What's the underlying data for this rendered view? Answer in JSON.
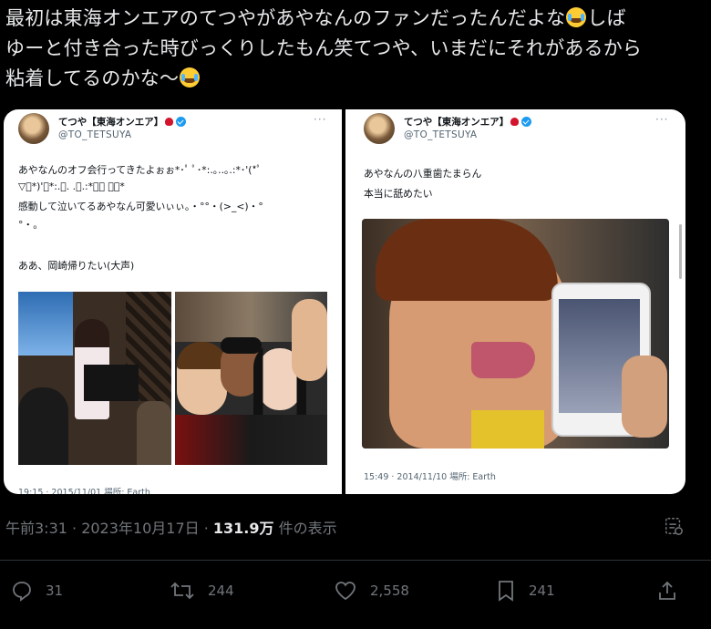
{
  "tweet": {
    "line1_a": "最初は東海オンエアのてつやがあやなんのファンだったんだよな",
    "line1_b": "しば",
    "line2": "ゆーと付き合った時びっくりしたもん笑てつや、いまだにそれがあるから",
    "line3": "粘着してるのかな〜",
    "emoji_name": "face-with-tears-of-joy-icon"
  },
  "left_card": {
    "display_name": "てつや【東海オンエア】",
    "handle": "@TO_TETSUYA",
    "more": "···",
    "lines": [
      "あやなんのオフ会行ってきたよぉぉ*･ﾟ ﾟ･*:.｡..｡.:*･'(*ﾟ",
      "▽ﾟ*)'･*:.｡. .｡.:*･ﾟ ﾟ･*",
      "感動して泣いてるあやなん可愛いぃぃ。・°°・(>_<)・°",
      "°・。",
      "",
      "ああ、岡崎帰りたい(大声)"
    ],
    "meta": "19:15 · 2015/11/01 場所: Earth"
  },
  "right_card": {
    "display_name": "てつや【東海オンエア】",
    "handle": "@TO_TETSUYA",
    "more": "···",
    "lines": [
      "あやなんの八重歯たまらん",
      "本当に舐めたい"
    ],
    "meta": "15:49 · 2014/11/10 場所: Earth"
  },
  "views": {
    "time": "午前3:31 · 2023年10月17日 · ",
    "count": "131.9万",
    "suffix": " 件の表示"
  },
  "actions": {
    "replies": "31",
    "reposts": "244",
    "likes": "2,558",
    "bookmarks": "241"
  },
  "colors": {
    "background": "#000000",
    "text": "#e7e9ea",
    "muted": "#71767b",
    "verified": "#1d9bf0"
  }
}
